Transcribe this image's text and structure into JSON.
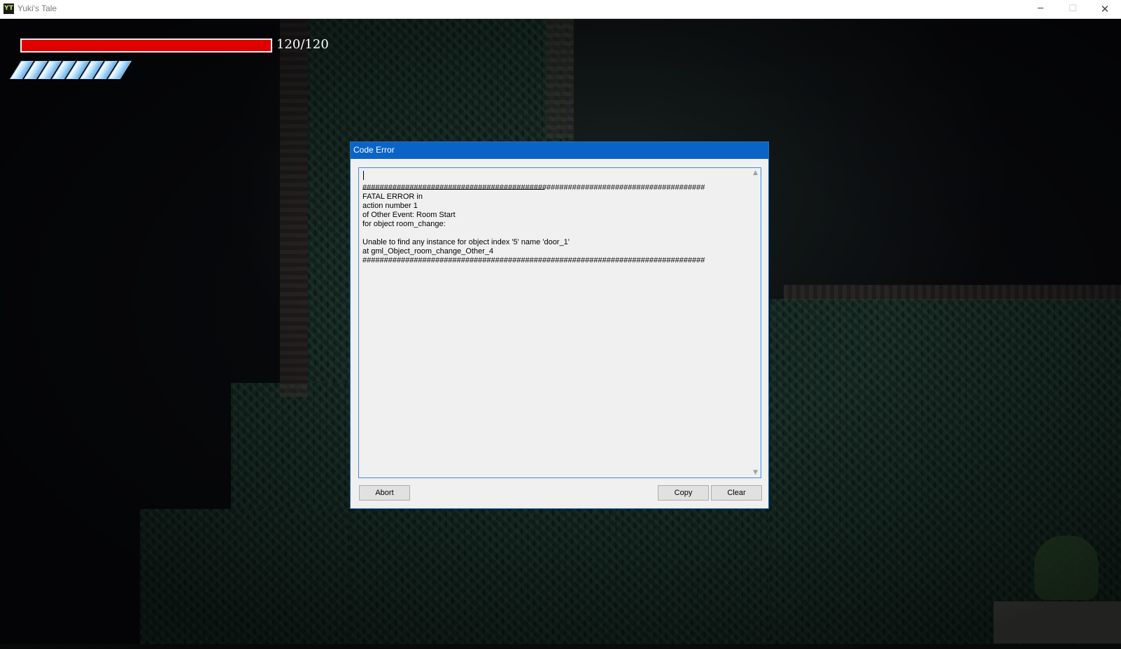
{
  "window": {
    "title": "Yuki's Tale",
    "app_icon": "game-app-icon",
    "controls": {
      "minimize": "─",
      "maximize": "☐",
      "close": "✕"
    }
  },
  "hud": {
    "health_text": "120/120",
    "health_fraction": 1.0,
    "health_color": "#e10000",
    "blade_count": 8,
    "blade_icon": "ice-blade-icon"
  },
  "dialog": {
    "title": "Code Error",
    "error_text": "################################################################################\nFATAL ERROR in\naction number 1\nof Other Event: Room Start\nfor object room_change:\n\nUnable to find any instance for object index '5' name 'door_1'\nat gml_Object_room_change_Other_4\n################################################################################",
    "buttons": {
      "abort": "Abort",
      "copy": "Copy",
      "clear": "Clear"
    },
    "scroll_up": "▲",
    "scroll_down": "▼"
  },
  "colors": {
    "dialog_title_bg": "#0a64c8",
    "accent_border": "#3d8ee0"
  }
}
